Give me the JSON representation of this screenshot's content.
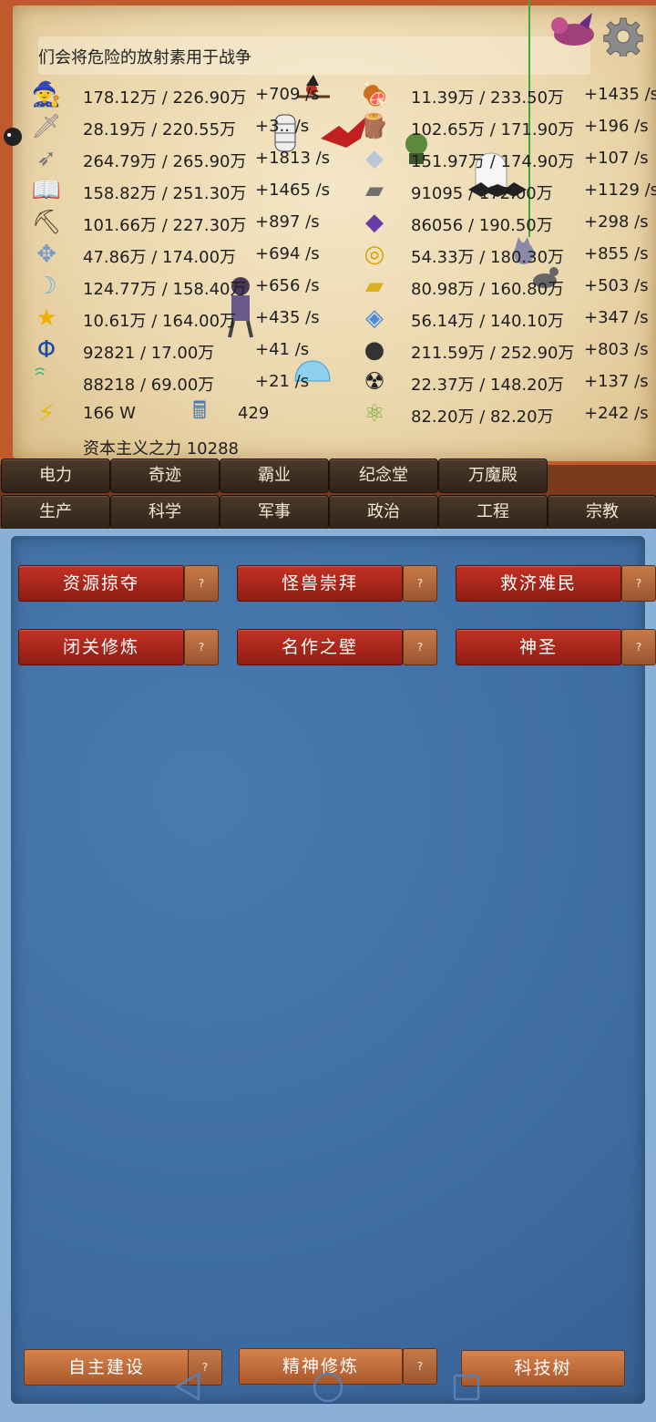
{
  "ticker": {
    "text": "们会将危险的放射素用于战争"
  },
  "left_resources": [
    {
      "icon": "wizard-hat-icon",
      "glyph": "🧙",
      "amount": "178.12万 / 226.90万",
      "rate": "+709 /s"
    },
    {
      "icon": "sword-icon",
      "glyph": "🗡",
      "amount": "28.19万 / 220.55万",
      "rate": "+3.. /s"
    },
    {
      "icon": "arrow-icon",
      "glyph": "➶",
      "amount": "264.79万 / 265.90万",
      "rate": "+1813 /s"
    },
    {
      "icon": "book-icon",
      "glyph": "📖",
      "amount": "158.82万 / 251.30万",
      "rate": "+1465 /s"
    },
    {
      "icon": "pickaxe-icon",
      "glyph": "⛏",
      "amount": "101.66万 / 227.30万",
      "rate": "+897 /s"
    },
    {
      "icon": "winged-emblem-icon",
      "glyph": "✥",
      "amount": "47.86万 / 174.00万",
      "rate": "+694 /s"
    },
    {
      "icon": "soul-icon",
      "glyph": "☽",
      "amount": "124.77万 / 158.40万",
      "rate": "+656 /s"
    },
    {
      "icon": "star-icon",
      "glyph": "★",
      "amount": "10.61万 / 164.00万",
      "rate": "+435 /s"
    },
    {
      "icon": "phi-icon",
      "glyph": "Φ",
      "amount": "92821 / 17.00万",
      "rate": "+41 /s"
    },
    {
      "icon": "spiral-icon",
      "glyph": "ꩰ",
      "amount": "88218 / 69.00万",
      "rate": "+21 /s"
    }
  ],
  "right_resources": [
    {
      "icon": "meat-icon",
      "glyph": "🍖",
      "amount": "11.39万 / 233.50万",
      "rate": "+1435 /s"
    },
    {
      "icon": "wood-icon",
      "glyph": "🪵",
      "amount": "102.65万 / 171.90万",
      "rate": "+196 /s"
    },
    {
      "icon": "stone-icon",
      "glyph": "◆",
      "amount": "151.97万 / 174.90万",
      "rate": "+107 /s"
    },
    {
      "icon": "iron-icon",
      "glyph": "▰",
      "amount": "91095 / 172.00万",
      "rate": "+1129 /s"
    },
    {
      "icon": "crystal-icon",
      "glyph": "◆",
      "amount": "86056 / 190.50万",
      "rate": "+298 /s"
    },
    {
      "icon": "coin-icon",
      "glyph": "◎",
      "amount": "54.33万 / 180.30万",
      "rate": "+855 /s"
    },
    {
      "icon": "gold-bar-icon",
      "glyph": "▰",
      "amount": "80.98万 / 160.80万",
      "rate": "+503 /s"
    },
    {
      "icon": "diamond-icon",
      "glyph": "◈",
      "amount": "56.14万 / 140.10万",
      "rate": "+347 /s"
    },
    {
      "icon": "coal-icon",
      "glyph": "●",
      "amount": "211.59万 / 252.90万",
      "rate": "+803 /s"
    },
    {
      "icon": "radiation-icon",
      "glyph": "☢",
      "amount": "22.37万 / 148.20万",
      "rate": "+137 /s"
    },
    {
      "icon": "atom-icon",
      "glyph": "⚛",
      "amount": "82.20万 / 82.20万",
      "rate": "+242 /s"
    }
  ],
  "power": {
    "icon": "lightning-icon",
    "glyph": "⚡",
    "value": "166 W"
  },
  "calculator": {
    "icon": "calculator-icon",
    "glyph": "🖩",
    "value": "429"
  },
  "capital": {
    "text": "资本主义之力 10288"
  },
  "tabs_row1": [
    "电力",
    "奇迹",
    "霸业",
    "纪念堂",
    "万魔殿"
  ],
  "tabs_row2": [
    "生产",
    "科学",
    "军事",
    "政治",
    "工程",
    "宗教"
  ],
  "actions": [
    {
      "label": "资源掠夺",
      "help": "?"
    },
    {
      "label": "怪兽崇拜",
      "help": "?"
    },
    {
      "label": "救济难民",
      "help": "?"
    },
    {
      "label": "闭关修炼",
      "help": "?"
    },
    {
      "label": "名作之壁",
      "help": "?"
    },
    {
      "label": "神圣",
      "help": "?"
    }
  ],
  "bottom": {
    "build": {
      "label": "自主建设",
      "help": "?"
    },
    "spirit": {
      "label": "精神修炼",
      "help": "?"
    },
    "tech": {
      "label": "科技树"
    }
  },
  "colors": {
    "accent_red": "#a82619",
    "panel_blue": "#4170a6",
    "tab_dark": "#3d2e21",
    "parchment": "#eedbb2"
  }
}
